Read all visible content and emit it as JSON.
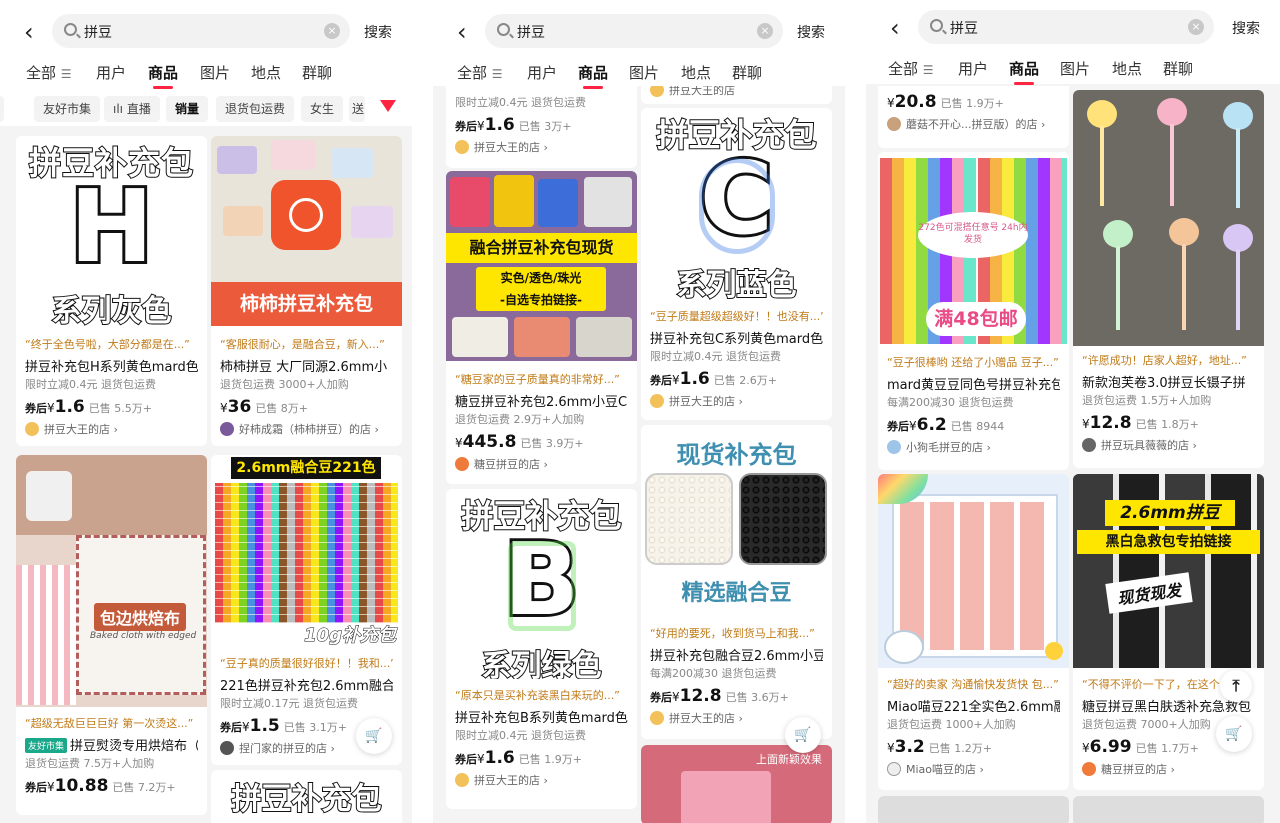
{
  "screens": [
    {
      "search": {
        "query": "拼豆",
        "clear": "×",
        "button": "搜索"
      },
      "tabs": [
        "全部",
        "用户",
        "商品",
        "图片",
        "地点",
        "群聊"
      ],
      "filters": [
        "友好市集",
        "直播",
        "销量",
        "退货包运费",
        "女生",
        "送"
      ],
      "cards": [
        {
          "img": {
            "line1": "拼豆补充包",
            "letter": "H",
            "line2": "系列灰色"
          },
          "quote": "“终于全色号啦，大部分都是在...”",
          "title": "拼豆补充包H系列黄色mard色",
          "sub": "限时立减0.4元  退货包运费",
          "pre": "券后",
          "yen": "¥",
          "price": "1.6",
          "sold": "已售 5.5万+",
          "shop": "拼豆大王的店 ›"
        },
        {
          "img": {
            "banner": "柿柿拼豆补充包"
          },
          "quote": "“客服很耐心，是融合豆，新入...”",
          "title": "柿柿拼豆 大厂同源2.6mm小",
          "sub": "退货包运费  3000+人加购",
          "pre": "",
          "yen": "¥",
          "price": "36",
          "sold": "已售 8万+",
          "shop": "好柿成霜（柿柿拼豆）的店 ›"
        },
        {
          "img": {
            "caption": "包边烘焙布",
            "script": "Baked cloth with edged"
          },
          "quote": "“超级无敌巨巨巨好 第一次烫这...”",
          "badge": "友好市集",
          "title": "拼豆熨烫专用烘焙布（",
          "sub": "退货包运费  7.5万+人加购",
          "pre": "券后",
          "yen": "¥",
          "price": "10.88",
          "sold": "已售 7.2万+",
          "shop": ""
        },
        {
          "img": {
            "head": "2.6mm融合豆221色",
            "foot": "10g补充包"
          },
          "quote": "“豆子真的质量很好很好！！我和...”",
          "title": "221色拼豆补充包2.6mm融合",
          "sub": "限时立减0.17元  退货包运费",
          "pre": "券后",
          "yen": "¥",
          "price": "1.5",
          "sold": "已售 3.1万+",
          "shop": "捏门家的拼豆的店 ›"
        },
        {
          "img": {
            "line1": "拼豆补充包"
          }
        }
      ]
    },
    {
      "search": {
        "query": "拼豆",
        "clear": "×",
        "button": "搜索"
      },
      "tabs": [
        "全部",
        "用户",
        "商品",
        "图片",
        "地点",
        "群聊"
      ],
      "cards": [
        {
          "sub": "限时立减0.4元  退货包运费",
          "pre": "券后",
          "yen": "¥",
          "price": "1.6",
          "sold": "已售 3万+",
          "shop": "拼豆大王的店 ›"
        },
        {
          "img": {
            "line1": "融合拼豆补充包现货",
            "line2": "实色/透色/珠光",
            "line3": "-自选专拍链接-"
          },
          "quote": "“糖豆家的豆子质量真的非常好...”",
          "title": "糖豆拼豆补充包2.6mm小豆C",
          "sub": "退货包运费  2.9万+人加购",
          "pre": "",
          "yen": "¥",
          "price": "445.8",
          "sold": "已售 3.9万+",
          "shop": "糖豆拼豆的店 ›"
        },
        {
          "img": {
            "line1": "拼豆补充包",
            "letter": "B",
            "line2": "系列绿色"
          },
          "quote": "“原本只是买补充装黑白来玩的...”",
          "title": "拼豆补充包B系列黄色mard色",
          "sub": "限时立减0.4元  退货包运费",
          "pre": "券后",
          "yen": "¥",
          "price": "1.6",
          "sold": "已售 1.9万+",
          "shop": "拼豆大王的店 ›"
        },
        {
          "shop": "拼豆大王的店"
        },
        {
          "img": {
            "line1": "拼豆补充包",
            "letter": "C",
            "line2": "系列蓝色"
          },
          "quote": "“豆子质量超级超级好！！也没有...”",
          "title": "拼豆补充包C系列黄色mard色",
          "sub": "限时立减0.4元  退货包运费",
          "pre": "券后",
          "yen": "¥",
          "price": "1.6",
          "sold": "已售 2.6万+",
          "shop": "拼豆大王的店 ›"
        },
        {
          "img": {
            "line1": "现货补充包",
            "line2": "精选融合豆"
          },
          "quote": "“好用的要死，收到货马上和我...”",
          "title": "拼豆补充包融合豆2.6mm小豆",
          "sub": "每满200减30  退货包运费",
          "pre": "券后",
          "yen": "¥",
          "price": "12.8",
          "sold": "已售 3.6万+",
          "shop": "拼豆大王的店 ›"
        },
        {
          "img": {
            "line1": "上面新颖效果"
          }
        }
      ]
    },
    {
      "search": {
        "query": "拼豆",
        "clear": "×",
        "button": "搜索"
      },
      "tabs": [
        "全部",
        "用户",
        "商品",
        "图片",
        "地点",
        "群聊"
      ],
      "cards": [
        {
          "pre": "",
          "yen": "¥",
          "price": "20.8",
          "sold": "已售 1.9万+",
          "shop": "蘑菇不开心...拼豆版）的店 ›"
        },
        {
          "img": {
            "note": "272色可混搭任意号 24h内发货",
            "promo": "满48包邮"
          },
          "quote": "“豆子很棒哟 还给了小赠品 豆子...”",
          "title": "mard黄豆豆同色号拼豆补充包",
          "sub": "每满200减30  退货包运费",
          "pre": "券后",
          "yen": "¥",
          "price": "6.2",
          "sold": "已售 8944",
          "shop": "小狗毛拼豆的店 ›"
        },
        {
          "quote": "“超好的卖家 沟通愉快发货快 包...”",
          "title": "Miao喵豆221全实色2.6mm融",
          "sub": "退货包运费  1000+人加购",
          "pre": "",
          "yen": "¥",
          "price": "3.2",
          "sold": "已售 1.2万+",
          "shop": "Miao喵豆的店 ›"
        },
        {
          "quote": "“许愿成功！店家人超好，地址...”",
          "title": "新款泡芙卷3.0拼豆长镊子拼",
          "sub": "退货包运费  1.5万+人加购",
          "pre": "",
          "yen": "¥",
          "price": "12.8",
          "sold": "已售 1.8万+",
          "shop": "拼豆玩具薇薇的店 ›"
        },
        {
          "img": {
            "head": "2.6mm拼豆",
            "sub": "黑白急救包专拍链接",
            "stamp": "现货现发"
          },
          "quote": "“不得不评价一下了，在这个...”",
          "title": "糖豆拼豆黑白肤透补充急救包",
          "sub": "退货包运费  7000+人加购",
          "pre": "",
          "yen": "¥",
          "price": "6.99",
          "sold": "已售 1.7万+",
          "shop": "糖豆拼豆的店 ›"
        }
      ]
    }
  ],
  "icons": {
    "back": "back-chevron-icon",
    "search": "search-icon",
    "filter": "filter-funnel-icon",
    "cart": "cart-icon",
    "up": "scroll-top-icon"
  },
  "colors": {
    "accent": "#ff2442",
    "quote": "#c07a16",
    "badge": "#1aa88a"
  }
}
